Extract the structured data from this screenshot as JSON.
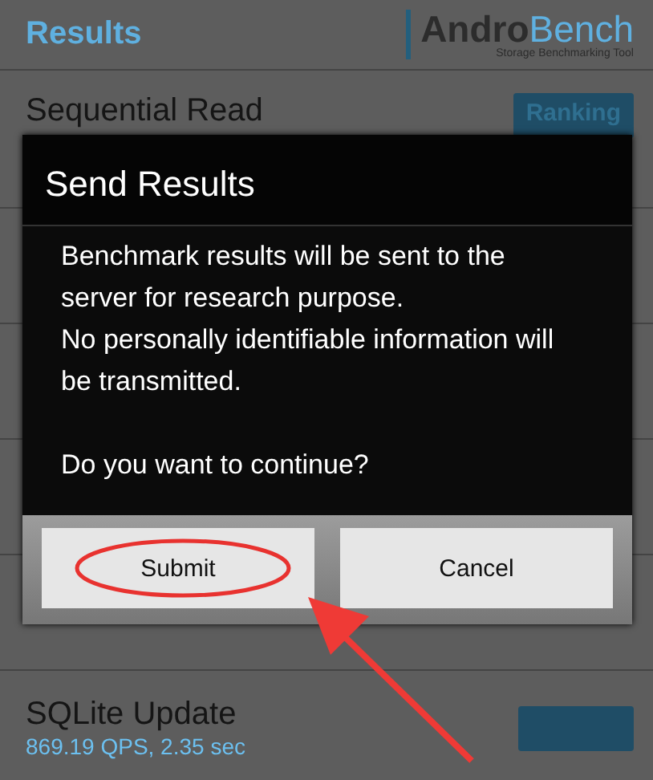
{
  "header": {
    "title": "Results",
    "logo": {
      "part_1": "Andro",
      "part_2": "Bench",
      "tagline": "Storage Benchmarking Tool"
    }
  },
  "rows": [
    {
      "kind": "visible",
      "title": "Sequential Read",
      "button": "Ranking"
    },
    {
      "kind": "covered"
    },
    {
      "kind": "covered"
    },
    {
      "kind": "covered"
    },
    {
      "kind": "covered"
    },
    {
      "kind": "visible",
      "title": "SQLite Update",
      "subtitle": "869.19 QPS, 2.35 sec"
    }
  ],
  "dialog": {
    "title": "Send Results",
    "message": [
      "Benchmark results will be sent to the server for research purpose.",
      "No personally identifiable information will be transmitted."
    ],
    "question": "Do you want to continue?",
    "buttons": [
      {
        "label": "Submit",
        "highlighted": true
      },
      {
        "label": "Cancel",
        "highlighted": false
      }
    ]
  }
}
